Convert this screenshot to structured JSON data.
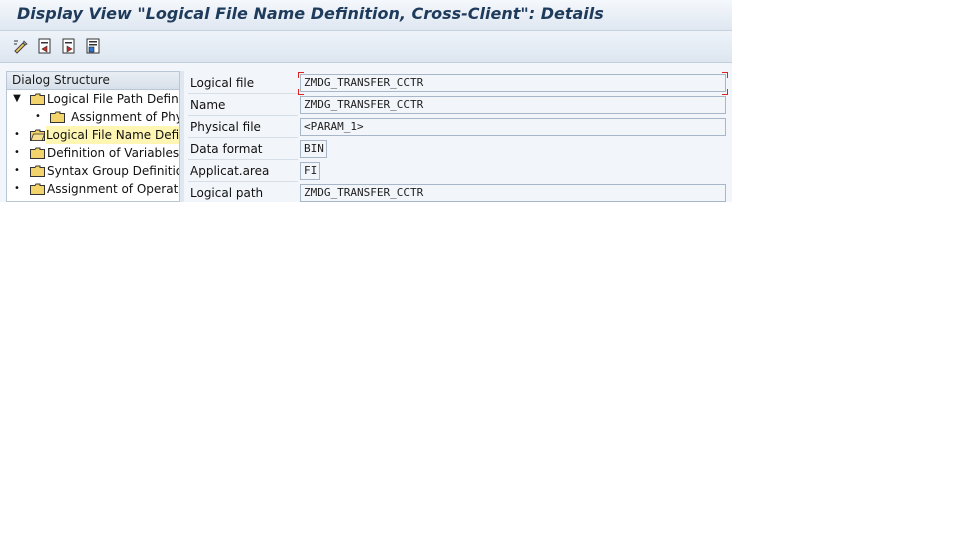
{
  "window": {
    "title": "Display View \"Logical File Name Definition, Cross-Client\": Details"
  },
  "toolbar": {
    "buttons": [
      {
        "icon": "display-change-icon"
      },
      {
        "icon": "previous-entry-icon"
      },
      {
        "icon": "next-entry-icon"
      },
      {
        "icon": "variable-list-icon"
      }
    ]
  },
  "dialog_structure": {
    "header": "Dialog Structure",
    "items": [
      {
        "label": "Logical File Path Definitio",
        "level": 0,
        "toggle": "▼",
        "selected": false
      },
      {
        "label": "Assignment of Physi",
        "level": 1,
        "toggle": "•",
        "selected": false
      },
      {
        "label": "Logical File Name Definit",
        "level": 0,
        "toggle": "•",
        "selected": true
      },
      {
        "label": "Definition of Variables",
        "level": 0,
        "toggle": "•",
        "selected": false
      },
      {
        "label": "Syntax Group Definition",
        "level": 0,
        "toggle": "•",
        "selected": false
      },
      {
        "label": "Assignment of Operating",
        "level": 0,
        "toggle": "•",
        "selected": false
      }
    ]
  },
  "form": {
    "fields": [
      {
        "label": "Logical file",
        "value": "ZMDG_TRANSFER_CCTR"
      },
      {
        "label": "Name",
        "value": "ZMDG_TRANSFER_CCTR"
      },
      {
        "label": "Physical file",
        "value": "<PARAM_1>"
      },
      {
        "label": "Data format",
        "value": "BIN"
      },
      {
        "label": "Applicat.area",
        "value": "FI"
      },
      {
        "label": "Logical path",
        "value": "ZMDG_TRANSFER_CCTR"
      }
    ]
  },
  "colors": {
    "title_text": "#1f3b5c",
    "selected_bg": "#fff6b3",
    "focus_corner": "#dd2222",
    "folder": "#f3d36b"
  }
}
